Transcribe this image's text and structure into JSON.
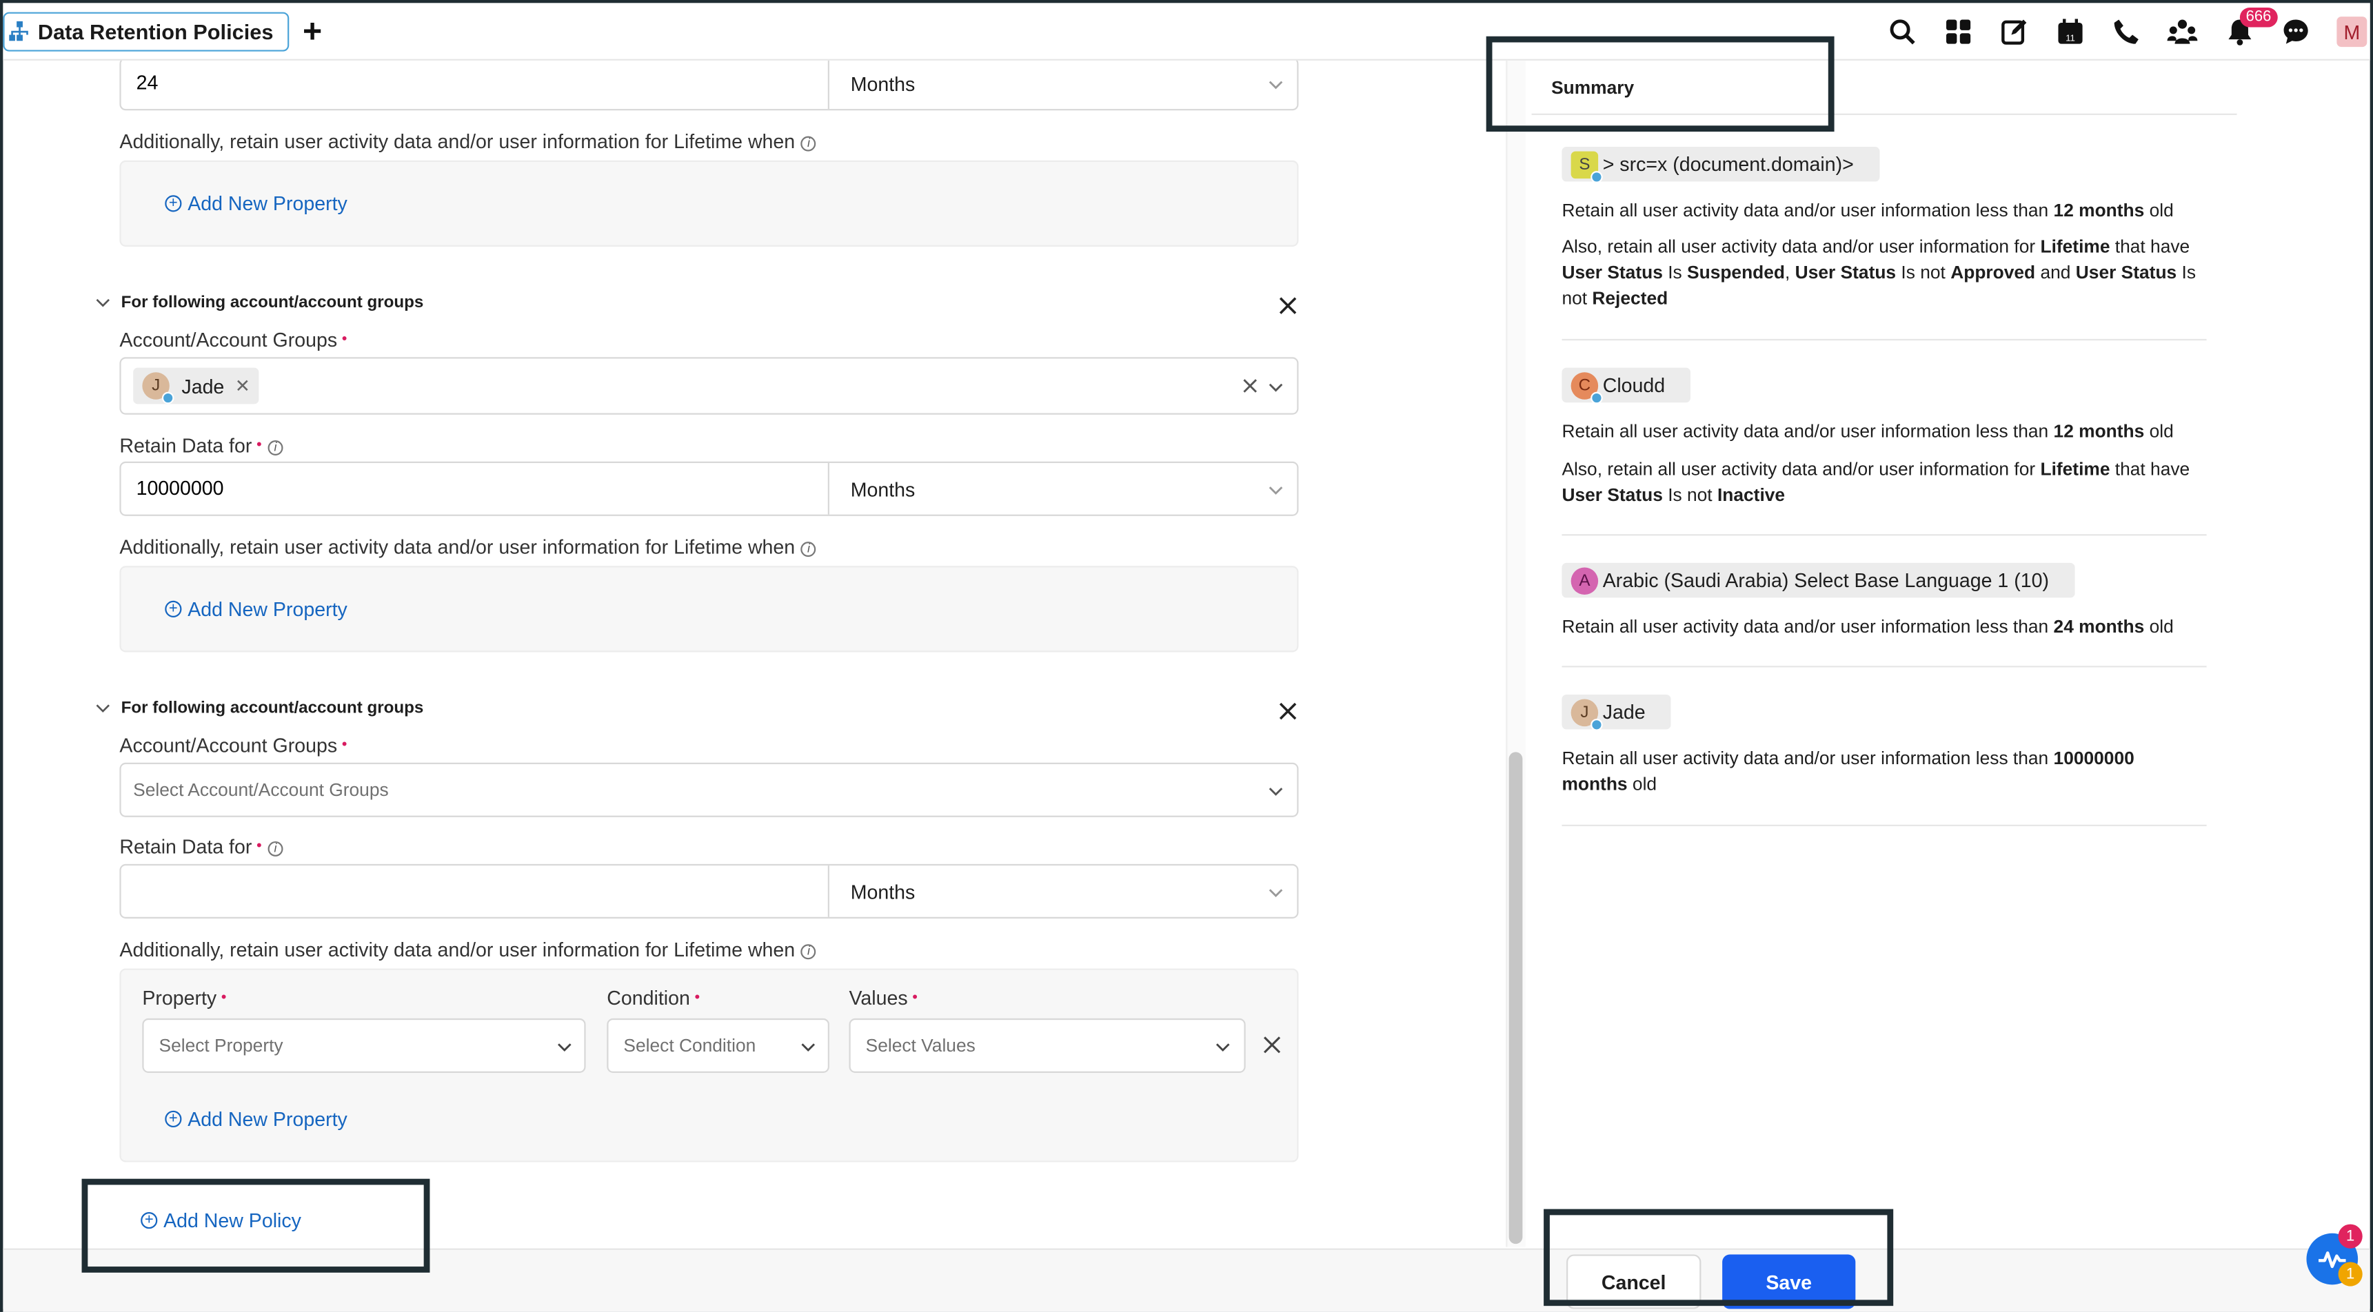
{
  "header": {
    "tab_title": "Data Retention Policies",
    "add_tab": "+",
    "notification_count": "666",
    "user_initial": "M",
    "icons": [
      "search-icon",
      "grid-icon",
      "compose-icon",
      "calendar-icon",
      "phone-icon",
      "community-icon",
      "bell-icon",
      "chat-icon"
    ]
  },
  "policy1": {
    "retain_value": "24",
    "retain_unit": "Months",
    "lifetime_label": "Additionally, retain user activity data and/or user information for Lifetime when",
    "add_property": "Add New Property"
  },
  "policy2": {
    "section_title": "For following account/account groups",
    "accounts_label": "Account/Account Groups",
    "selected_account": "Jade",
    "selected_account_initial": "J",
    "retain_label": "Retain Data for",
    "retain_value": "10000000",
    "retain_unit": "Months",
    "lifetime_label": "Additionally, retain user activity data and/or user information for Lifetime when",
    "add_property": "Add New Property"
  },
  "policy3": {
    "section_title": "For following account/account groups",
    "accounts_label": "Account/Account Groups",
    "accounts_placeholder": "Select Account/Account Groups",
    "retain_label": "Retain Data for",
    "retain_value": "",
    "retain_unit": "Months",
    "lifetime_label": "Additionally, retain user activity data and/or user information for Lifetime when",
    "property_label": "Property",
    "property_placeholder": "Select Property",
    "condition_label": "Condition",
    "condition_placeholder": "Select Condition",
    "values_label": "Values",
    "values_placeholder": "Select Values",
    "add_property": "Add New Property"
  },
  "add_policy": "Add New Policy",
  "summary": {
    "title": "Summary",
    "items": [
      {
        "initial": "S",
        "name": "> src=x (document.domain)>",
        "line1": [
          "Retain all user activity data and/or user information less than ",
          "12 months",
          " old"
        ],
        "line2": [
          "Also, retain all user activity data and/or user information for ",
          "Lifetime",
          " that have",
          "User Status",
          " Is ",
          "Suspended",
          ", ",
          "User Status",
          " Is not ",
          "Approved",
          " and ",
          "User Status",
          " Is",
          "not ",
          "Rejected"
        ]
      },
      {
        "initial": "C",
        "name": "Cloudd",
        "line1": [
          "Retain all user activity data and/or user information less than ",
          "12 months",
          " old"
        ],
        "line2": [
          "Also, retain all user activity data and/or user information for ",
          "Lifetime",
          " that have",
          "User Status",
          " Is not ",
          "Inactive"
        ]
      },
      {
        "initial": "A",
        "name": "Arabic (Saudi Arabia) Select Base Language 1 (10)",
        "line1": [
          "Retain all user activity data and/or user information less than ",
          "24 months",
          " old"
        ]
      },
      {
        "initial": "J",
        "name": "Jade",
        "line1": [
          "Retain all user activity data and/or user information less than ",
          "10000000",
          "months",
          " old"
        ]
      }
    ]
  },
  "footer": {
    "cancel": "Cancel",
    "save": "Save"
  },
  "fab": {
    "badge_top": "1",
    "badge_bottom": "1"
  },
  "colors": {
    "accent": "#1565c0",
    "save_button": "#1a5ff0",
    "required": "#d81b60",
    "badge": "#e0245e"
  }
}
